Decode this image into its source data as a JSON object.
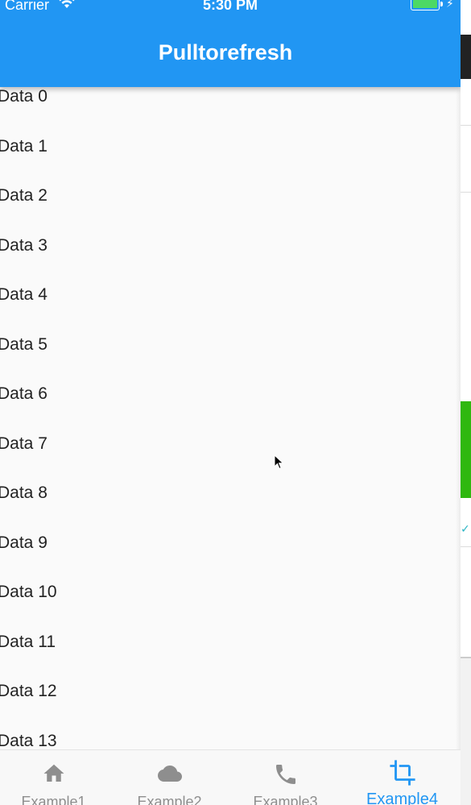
{
  "status_bar": {
    "carrier": "Carrier",
    "time": "5:30 PM"
  },
  "app_bar": {
    "title": "Pulltorefresh",
    "color": "#2196f3"
  },
  "list": {
    "items": [
      "Data 0",
      "Data 1",
      "Data 2",
      "Data 3",
      "Data 4",
      "Data 5",
      "Data 6",
      "Data 7",
      "Data 8",
      "Data 9",
      "Data 10",
      "Data 11",
      "Data 12",
      "Data 13"
    ]
  },
  "bottom_nav": {
    "items": [
      {
        "label": "Example1",
        "icon": "home-icon"
      },
      {
        "label": "Example2",
        "icon": "cloud-icon"
      },
      {
        "label": "Example3",
        "icon": "phone-icon"
      },
      {
        "label": "Example4",
        "icon": "crop-icon"
      }
    ],
    "active_index": 3,
    "active_color": "#2196f3",
    "inactive_color": "#8e8e8e"
  }
}
